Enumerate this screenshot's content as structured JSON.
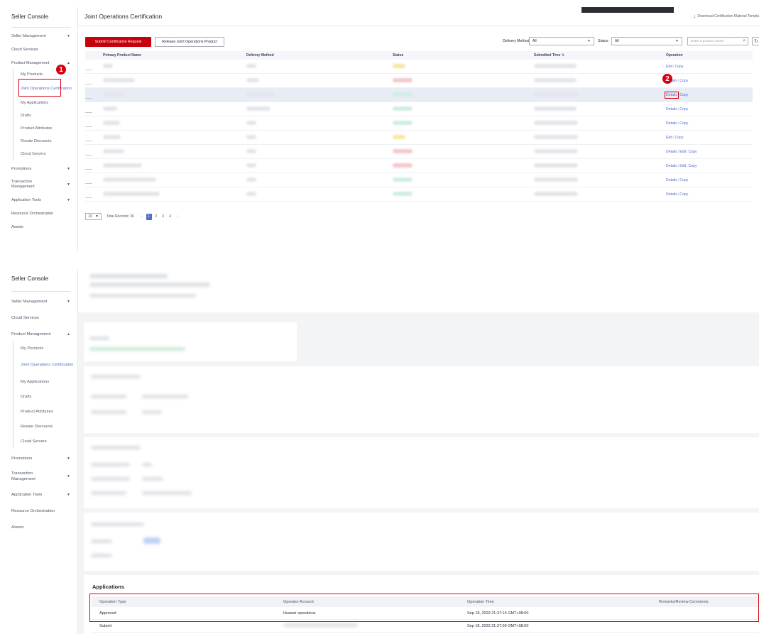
{
  "sidebar": {
    "title": "Seller Console",
    "seller_management": "Seller Management",
    "cloud_services": "Cloud Services",
    "product_management": "Product Management",
    "sub": [
      "My Products",
      "Joint Operations Certification",
      "My Applications",
      "Drafts",
      "Product Attributes",
      "Resale Discounts",
      "Cloud Servers"
    ],
    "promotions": "Promotions",
    "transaction_management": "Transaction Management",
    "application_tools": "Application Tools",
    "resource_orchestration": "Resource Orchestration",
    "assets": "Assets"
  },
  "header": {
    "title": "Joint Operations Certification",
    "download": "Download Certification Material Templa"
  },
  "toolbar": {
    "submit": "Submit Certification Request",
    "release": "Release Joint Operations Product",
    "delivery_label": "Delivery Method",
    "delivery_value": "All",
    "status_label": "Status",
    "status_value": "All",
    "search_placeholder": "Enter a product name"
  },
  "grid": {
    "columns": [
      "Primary Product Name",
      "Delivery Method",
      "Status",
      "Submitted Time",
      "Operation"
    ],
    "operations": [
      [
        "Edit",
        "Copy"
      ],
      [
        "Details",
        "Copy"
      ],
      [
        "Details",
        "Copy"
      ],
      [
        "Details",
        "Copy"
      ],
      [
        "Details",
        "Copy"
      ],
      [
        "Edit",
        "Copy"
      ],
      [
        "Details",
        "Edit",
        "Copy"
      ],
      [
        "Details",
        "Edit",
        "Copy"
      ],
      [
        "Details",
        "Copy"
      ],
      [
        "Details",
        "Copy"
      ]
    ]
  },
  "pager": {
    "size": "10",
    "total": "Total Records: 36",
    "pages": [
      "1",
      "2",
      "3",
      "4"
    ]
  },
  "markers": {
    "one": "1",
    "two": "2"
  },
  "applications": {
    "title": "Applications",
    "columns": [
      "Operation Type",
      "Operator Account",
      "Operation Time",
      "Remarks/Review Comments"
    ],
    "rows": [
      {
        "type": "Approved",
        "account": "Huawei operations",
        "time": "Sep 18, 2023 21:37:16 GMT+08:00",
        "remarks": ""
      },
      {
        "type": "Submit",
        "account": "",
        "time": "Sep 18, 2023 21:37:00 GMT+08:00",
        "remarks": ""
      }
    ]
  },
  "colors": {
    "brand_red": "#c7000b",
    "link_blue": "#526ecc",
    "highlight_red": "#d7000f"
  },
  "icons": [
    "download-icon",
    "chevron-down-icon",
    "search-icon",
    "refresh-icon",
    "sort-icon",
    "chevron-left-icon",
    "chevron-right-icon"
  ]
}
